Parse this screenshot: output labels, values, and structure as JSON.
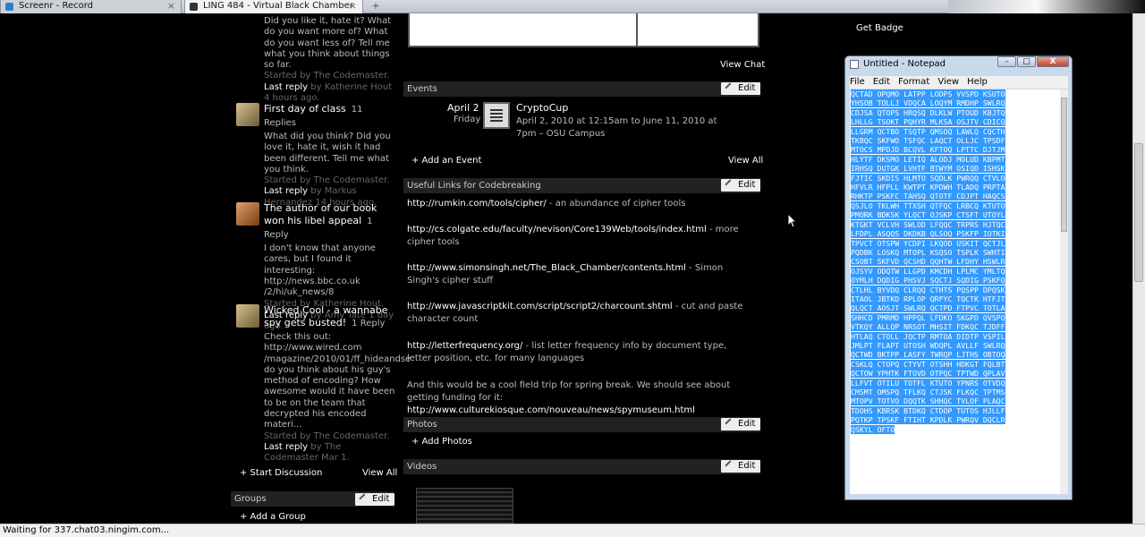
{
  "browser": {
    "tabs": [
      {
        "label": "Screenr - Record",
        "favicon_color": "#2a7fd4"
      },
      {
        "label": "LING 484 - Virtual Black Chamber",
        "favicon_color": "#333333"
      }
    ],
    "new_tab_label": "+"
  },
  "discussions": {
    "items": [
      {
        "body": "Did you like it, hate it?  What do you want more of?  What do you want less of? Tell me what you think about things so far.",
        "started_by": "Started by The Codemaster.",
        "last_reply_label": "Last reply",
        "last_reply_by": "by Katherine Hout 4 hours ago."
      },
      {
        "title": "First day of class",
        "replies": "11 Replies",
        "body": "What did you think?  Did you love it, hate it, wish it had been different.  Tell me what you think.",
        "started_by": "Started by The Codemaster.",
        "last_reply_label": "Last reply",
        "last_reply_by": "by Markus Hernandez 14 hours ago."
      },
      {
        "title": "The author of our book won his libel appeal",
        "replies": "1 Reply",
        "body": "I don't know that anyone cares, but I found it interesting: http://news.bbc.co.uk /2/hi/uk_news/8",
        "started_by": "Started by Katherine Hout.",
        "last_reply_label": "Last reply",
        "last_reply_by": "by Amy Tate 1 day ago."
      },
      {
        "title": "Wicked Cool - a wannabe spy gets busted!",
        "replies": "1 Reply",
        "body": "Check this out: http://www.wired.com /magazine/2010/01/ff_hideandse do you think about his guy's method of encoding?  How awesome would it have been to be on the team that decrypted his encoded materi...",
        "started_by": "Started by The Codemaster.",
        "last_reply_label": "Last reply",
        "last_reply_by": "by The Codemaster Mar 1."
      }
    ],
    "start_label": "+ Start Discussion",
    "view_all": "View All"
  },
  "groups": {
    "header": "Groups",
    "edit": "Edit",
    "add": "+ Add a Group"
  },
  "chat": {
    "view_chat": "View Chat"
  },
  "events": {
    "header": "Events",
    "edit": "Edit",
    "date": "April 2",
    "weekday": "Friday",
    "name": "CryptoCup",
    "details": "April 2, 2010 at 12:15am to June 11, 2010 at 7pm – OSU Campus",
    "add": "+ Add an Event",
    "view_all": "View All"
  },
  "links": {
    "header": "Useful Links for Codebreaking",
    "edit": "Edit",
    "items": [
      {
        "url": "http://rumkin.com/tools/cipher/",
        "desc": " - an abundance of cipher tools"
      },
      {
        "url": "http://cs.colgate.edu/faculty/nevison/Core139Web/tools/index.html",
        "desc": " - more cipher tools"
      },
      {
        "url": "http://www.simonsingh.net/The_Black_Chamber/contents.html",
        "desc": " - Simon Singh's cipher stuff"
      },
      {
        "url": "http://www.javascriptkit.com/script/script2/charcount.shtml",
        "desc": " - cut and paste character count"
      },
      {
        "url": "http://letterfrequency.org/",
        "desc": " - list letter frequency info by document type, letter position, etc. for many languages"
      }
    ],
    "note_text": "And this would be a cool field trip for spring break. We should see about getting funding for it: ",
    "note_url": "http://www.culturekiosque.com/nouveau/news/spymuseum.html"
  },
  "photos": {
    "header": "Photos",
    "edit": "Edit",
    "add": "+ Add Photos"
  },
  "videos": {
    "header": "Videos",
    "edit": "Edit"
  },
  "right": {
    "get_badge": "Get Badge"
  },
  "notepad": {
    "title": "Untitled - Notepad",
    "menu": [
      "File",
      "Edit",
      "Format",
      "View",
      "Help"
    ],
    "minimize": "–",
    "maximize": "□",
    "close": "X",
    "lines": [
      "QCTAD OPQMO LATPP LODPS VVSPD KSUTO",
      "YHSOB TOLLJ VDQCA LOQYM RMDHP SWLRQ",
      "CDJSA QTOPS HRQSQ DLKLW PTOUD KBJTQ",
      "LHLLG TSOKT PQHYR MLKSA OSJTV CDICQ",
      "LLGRM QCTBO TSQTP QMSOQ LAWLQ CQCTH",
      "TKBQC SKFWO TSFQC LAQCT OLLJC TPSDF",
      "MTOCS MPDJD BCQVL KFTOQ LPTTC DJTJM",
      "HLYTF DKSMO LETIQ ALODJ MOLUD KBPMT",
      "IRHSQ DUTGK LVHTF BTWYM OSIQD ISHSK",
      "FJTIC SKDIS HLMTO SQDLK PWRQQ CTVLO",
      "HFVLR HFPLL KWTPT KPDWH TLADQ PRPTA",
      "RHKTP PSKFC TAHSQ QTOTF CDJPT HAQCS",
      "QSJLO TKLWH TTXSH QTFQC LRBCQ KTUTO",
      "PMORK BDKSK YLQCT OJSKP CTSFT UTOYL",
      "KTGKT VCLVH SWLOD LFQQC TRPRS HJTQC",
      "LFDPL ASQQS DKDKB QLSOQ PSKFP IOTKI",
      "TPVCT OTSPW YCDPI LKQOD USKIT QCTJL",
      "PQDBK LOSKQ MTOPL KSQSO TSPLK SWHTI",
      "CSOBT SKFVD QCSHD QQHTW LFDHY HSWLR",
      "OJSYV ODQTW LLGPD KMCDH LPLMC YMLTQ",
      "OYMLH DQDIG PHSVJ SQCTJ SQDIG PSKFQ",
      "CTLHL BYVDQ CLRQQ CTHTS PQSPP DPQSK",
      "ITAOL JBTKD RPLOP QRFYC TQCTK HTFJT",
      "QLQCT AOSJT SWLRQ QCTPD FTPVC TOTLA",
      "SHHCD PMRMD HPPQL LFDKO SKGPD QVSPQ",
      "VTKQY ALLQP NRSOT MHSIT FDKQC TJDFF",
      "HTLAQ CTOLL JQCTP RMTOA DIDTP VSPIL",
      "JMLPT FLAPT UTOSH WDQPL AVLLF SWLRQ",
      "QCTWD BKTPP LASFY TWRQP LJTHS OBTOQ",
      "CSKLQ CTOPQ CTYVT OTSHH HDKGT FQLBT",
      "QCTOW YPHTK FTOVD OTPQC TPTWD QPLAV",
      "LLFVT OTILU TOTFL KTUTO YPNRS OTVDQ",
      "CMSMT OMSPQ TFLKQ CTJSK FLKQC TPTMS",
      "MTOPV TOTVO DQQTK SHHQC TVLOF PLAQC",
      "TDOHS KBRSK BTDKQ CTDOP TUTOS HJLLF",
      "PQTKP TPSKF FTIHT KPDLK PWRQV DQCLR",
      "QSKYL OFTO"
    ]
  },
  "status": {
    "text": "Waiting for 337.chat03.ningim.com..."
  }
}
